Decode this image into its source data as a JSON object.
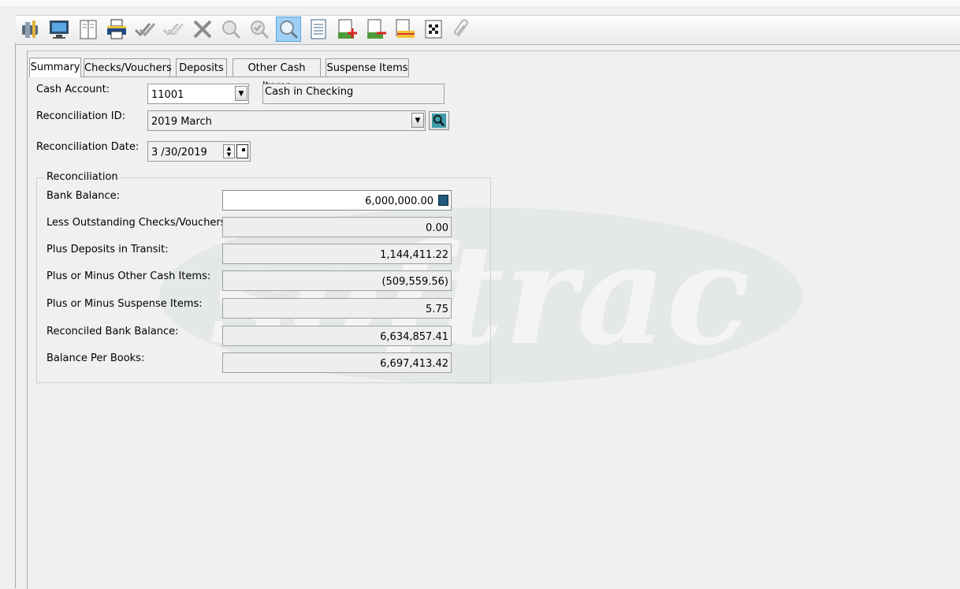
{
  "watermark": {
    "text": "softrac"
  },
  "toolbar": {
    "buttons": [
      {
        "icon": "tools-icon"
      },
      {
        "icon": "monitor-icon"
      },
      {
        "icon": "notebook-icon"
      },
      {
        "icon": "printer-icon"
      },
      {
        "icon": "double-check-icon"
      },
      {
        "icon": "double-check-dim-icon"
      },
      {
        "icon": "delete-x-icon"
      },
      {
        "icon": "magnify-icon"
      },
      {
        "icon": "check-magnify-icon"
      },
      {
        "icon": "find-icon",
        "active": true
      },
      {
        "icon": "list-icon"
      },
      {
        "icon": "ledger-add-icon"
      },
      {
        "icon": "ledger-remove-icon"
      },
      {
        "icon": "ledger-note-icon"
      },
      {
        "icon": "finish-flag-icon"
      },
      {
        "icon": "paperclip-icon"
      }
    ]
  },
  "tabs": [
    {
      "label": "Summary",
      "active": true
    },
    {
      "label": "Checks/Vouchers"
    },
    {
      "label": "Deposits"
    },
    {
      "label": "Other Cash Items"
    },
    {
      "label": "Suspense Items"
    }
  ],
  "form": {
    "cash_account": {
      "label": "Cash Account:",
      "value": "11001",
      "description": "Cash in Checking"
    },
    "reconciliation_id": {
      "label": "Reconciliation ID:",
      "value": "2019 March"
    },
    "reconciliation_date": {
      "label": "Reconciliation Date:",
      "value": "3 /30/2019"
    }
  },
  "reconciliation": {
    "title": "Reconciliation",
    "rows": [
      {
        "label": "Bank Balance:",
        "value": "6,000,000.00"
      },
      {
        "label": "Less Outstanding Checks/Vouchers:",
        "value": "0.00"
      },
      {
        "label": "Plus Deposits in Transit:",
        "value": "1,144,411.22"
      },
      {
        "label": "Plus or Minus Other Cash Items:",
        "value": "(509,559.56)"
      },
      {
        "label": "Plus or Minus Suspense Items:",
        "value": "5.75"
      },
      {
        "label": "Reconciled Bank Balance:",
        "value": "6,634,857.41"
      },
      {
        "label": "Balance Per Books:",
        "value": "6,697,413.42"
      }
    ]
  }
}
